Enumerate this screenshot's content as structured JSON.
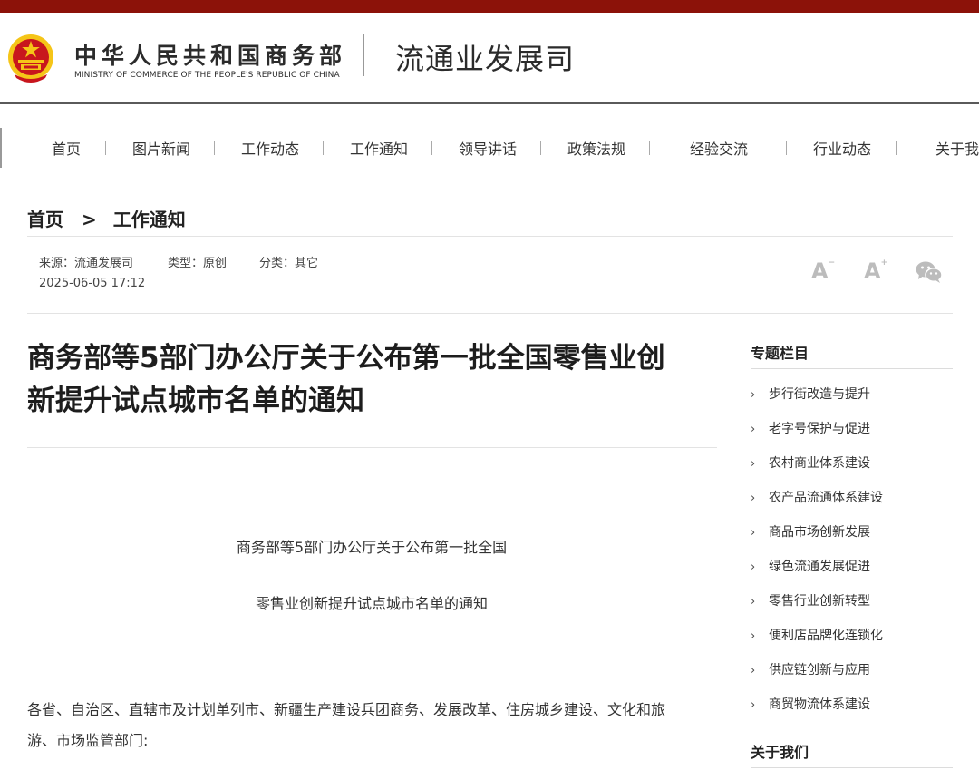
{
  "colors": {
    "top_bar": "#8c1209",
    "emblem_red": "#c8161d",
    "emblem_gold": "#f5c518",
    "tool_icon": "#bcbcbc"
  },
  "header": {
    "emblem_icon": "national-emblem-icon",
    "ministry_cn": "中华人民共和国商务部",
    "ministry_en": "MINISTRY OF COMMERCE OF THE PEOPLE'S REPUBLIC OF CHINA",
    "department": "流通业发展司"
  },
  "nav": {
    "items": [
      {
        "label": "首页"
      },
      {
        "label": "图片新闻"
      },
      {
        "label": "工作动态"
      },
      {
        "label": "工作通知"
      },
      {
        "label": "领导讲话"
      },
      {
        "label": "政策法规"
      },
      {
        "label": "经验交流"
      },
      {
        "label": "行业动态"
      },
      {
        "label": "关于我"
      }
    ]
  },
  "breadcrumb": {
    "home": "首页",
    "separator": ">",
    "current": "工作通知"
  },
  "meta": {
    "source": "来源：流通发展司",
    "type": "类型：原创",
    "category": "分类：其它",
    "datetime": "2025-06-05 17:12"
  },
  "tools": {
    "font_decrease_icon": "font-size-decrease-icon",
    "font_increase_icon": "font-size-increase-icon",
    "wechat_icon": "wechat-share-icon",
    "font_letter": "A"
  },
  "article": {
    "title_line1": "商务部等5部门办公厅关于公布第一批全国零售业创",
    "title_line2": "新提升试点城市名单的通知",
    "center_line1": "商务部等5部门办公厅关于公布第一批全国",
    "center_line2": "零售业创新提升试点城市名单的通知",
    "body_line1": "各省、自治区、直辖市及计划单列市、新疆生产建设兵团商务、发展改革、住房城乡建设、文化和旅",
    "body_line2": "游、市场监管部门:"
  },
  "sidebar": {
    "topics_title": "专题栏目",
    "chevron": "›",
    "items": [
      {
        "label": "步行街改造与提升"
      },
      {
        "label": "老字号保护与促进"
      },
      {
        "label": "农村商业体系建设"
      },
      {
        "label": "农产品流通体系建设"
      },
      {
        "label": "商品市场创新发展"
      },
      {
        "label": "绿色流通发展促进"
      },
      {
        "label": "零售行业创新转型"
      },
      {
        "label": "便利店品牌化连锁化"
      },
      {
        "label": "供应链创新与应用"
      },
      {
        "label": "商贸物流体系建设"
      }
    ],
    "about_title": "关于我们"
  }
}
